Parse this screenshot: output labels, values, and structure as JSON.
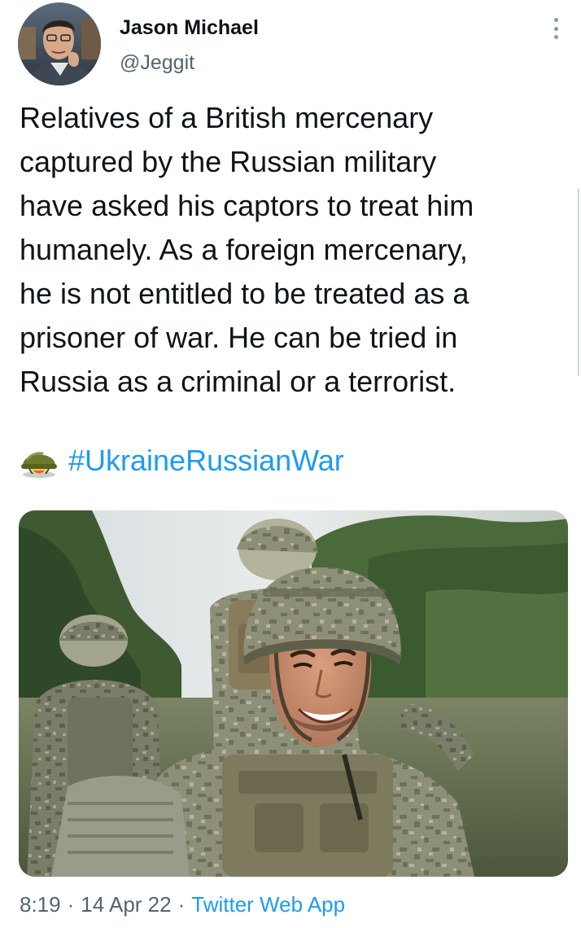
{
  "author": {
    "display_name": "Jason Michael",
    "handle": "@Jeggit"
  },
  "tweet": {
    "text_lines": [
      "Relatives of a British mercenary",
      "captured by the Russian military",
      "have asked his captors to treat him",
      "humanely. As a foreign mercenary,",
      "he is not entitled to be treated as a",
      "prisoner of war. He can be tried in",
      "Russia as a criminal or a terrorist."
    ],
    "hashtag_emoji_icon": "military-helmet-icon",
    "hashtag": "#UkraineRussianWar"
  },
  "meta": {
    "time": "8:19",
    "separator": "·",
    "date": "14 Apr 22",
    "source": "Twitter Web App"
  },
  "icons": {
    "more": "more-vertical-icon"
  },
  "colors": {
    "link": "#1d9bf0",
    "muted_text": "#536471",
    "body_text": "#0f1419"
  }
}
